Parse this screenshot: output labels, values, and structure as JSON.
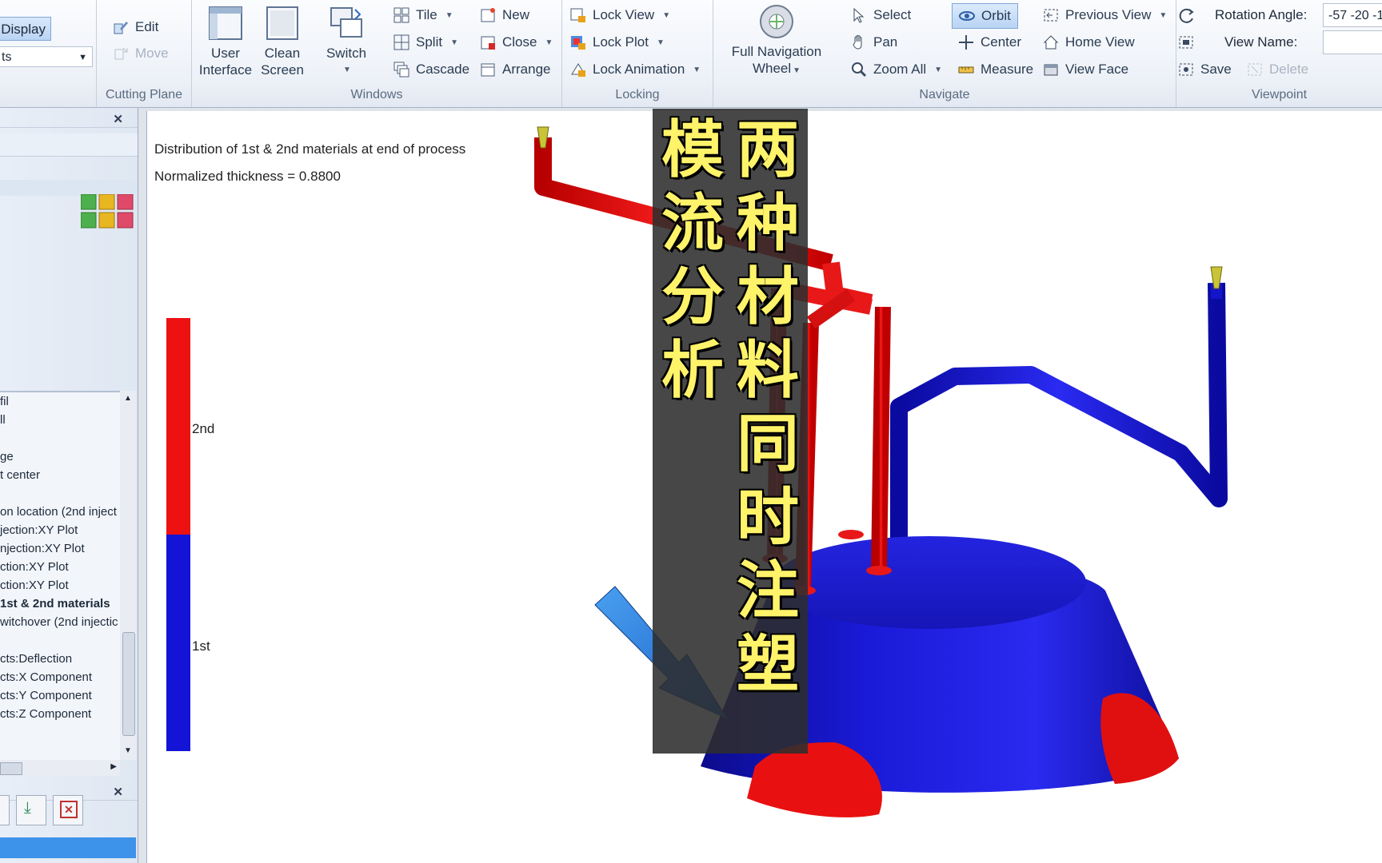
{
  "ribbon": {
    "display_button": "Display",
    "display_dropdown_value": "ts",
    "cutting_plane": {
      "label": "Cutting Plane",
      "edit": "Edit",
      "move": "Move"
    },
    "windows": {
      "label": "Windows",
      "user_interface": "User Interface",
      "clean_screen": "Clean Screen",
      "switch": "Switch",
      "tile": "Tile",
      "split": "Split",
      "cascade": "Cascade",
      "new": "New",
      "close": "Close",
      "arrange": "Arrange"
    },
    "locking": {
      "label": "Locking",
      "lock_view": "Lock View",
      "lock_plot": "Lock Plot",
      "lock_animation": "Lock Animation"
    },
    "navigate": {
      "label": "Navigate",
      "full_navigation_wheel": "Full Navigation Wheel",
      "select": "Select",
      "pan": "Pan",
      "zoom_all": "Zoom All",
      "orbit": "Orbit",
      "center": "Center",
      "measure": "Measure",
      "previous_view": "Previous View",
      "home_view": "Home View",
      "view_face": "View Face"
    },
    "viewpoint": {
      "label": "Viewpoint",
      "rotation_angle_label": "Rotation Angle:",
      "rotation_angle_value": "-57 -20 -1",
      "view_name_label": "View Name:",
      "view_name_value": "",
      "save": "Save",
      "delete": "Delete"
    }
  },
  "left_panel": {
    "tree_items": [
      "fil",
      "ll",
      "",
      "ge",
      "t center",
      "",
      "on location (2nd inject",
      "jection:XY Plot",
      "njection:XY Plot",
      "ction:XY Plot",
      "ction:XY Plot",
      "1st & 2nd materials",
      "witchover (2nd injectic",
      "",
      "cts:Deflection",
      "cts:X Component",
      "cts:Y Component",
      "cts:Z Component"
    ],
    "selected_index": 11
  },
  "viewport": {
    "result_title": "Distribution of 1st & 2nd materials at end of process",
    "normalized_thickness": "Normalized thickness = 0.8800",
    "legend": [
      {
        "label": "2nd",
        "color": "#ee1111"
      },
      {
        "label": "1st",
        "color": "#1414d6"
      }
    ],
    "legend_split_fraction": 0.5
  },
  "overlay": {
    "column_right": "两种材料同时注塑",
    "column_left": "模流分析",
    "text_color": "#fff36a"
  }
}
